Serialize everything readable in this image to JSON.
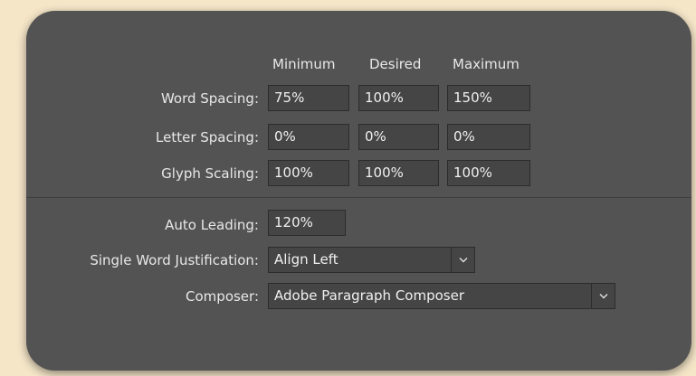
{
  "columns": {
    "minimum": "Minimum",
    "desired": "Desired",
    "maximum": "Maximum"
  },
  "rows": [
    {
      "label": "Word Spacing:",
      "minimum": "75%",
      "desired": "100%",
      "maximum": "150%"
    },
    {
      "label": "Letter Spacing:",
      "minimum": "0%",
      "desired": "0%",
      "maximum": "0%"
    },
    {
      "label": "Glyph Scaling:",
      "minimum": "100%",
      "desired": "100%",
      "maximum": "100%"
    }
  ],
  "auto_leading": {
    "label": "Auto Leading:",
    "value": "120%"
  },
  "single_word_justification": {
    "label": "Single Word Justification:",
    "value": "Align Left"
  },
  "composer": {
    "label": "Composer:",
    "value": "Adobe Paragraph Composer"
  },
  "icons": {
    "dropdown": "chevron-down-icon"
  },
  "colors": {
    "panel": "#535353",
    "field": "#454545",
    "background": "#f5e6c8",
    "text": "#e8e8e8"
  }
}
